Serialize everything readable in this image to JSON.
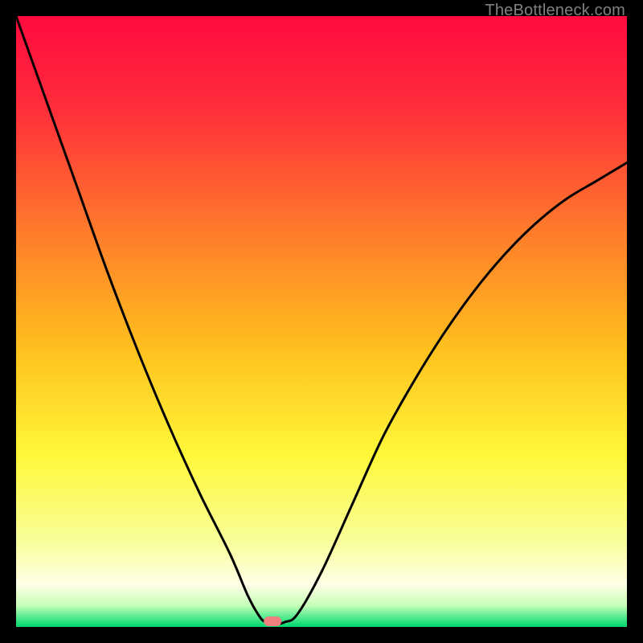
{
  "watermark": "TheBottleneck.com",
  "chart_data": {
    "type": "line",
    "title": "",
    "xlabel": "",
    "ylabel": "",
    "xlim": [
      0,
      100
    ],
    "ylim": [
      0,
      100
    ],
    "x_marker": 42,
    "curve": {
      "x": [
        0,
        5,
        10,
        15,
        20,
        25,
        30,
        35,
        38,
        40,
        41,
        42,
        43,
        44,
        46,
        50,
        55,
        60,
        65,
        70,
        75,
        80,
        85,
        90,
        95,
        100
      ],
      "y": [
        100,
        86,
        72,
        58,
        45,
        33,
        22,
        12,
        5,
        1.5,
        0.8,
        0.5,
        0.5,
        0.8,
        2,
        9,
        20,
        31,
        40,
        48,
        55,
        61,
        66,
        70,
        73,
        76
      ]
    },
    "background_gradient": {
      "stops": [
        {
          "pos": 0.0,
          "color": "#ff0b3f"
        },
        {
          "pos": 0.15,
          "color": "#ff2d3b"
        },
        {
          "pos": 0.35,
          "color": "#ff7a2b"
        },
        {
          "pos": 0.55,
          "color": "#ffc21e"
        },
        {
          "pos": 0.72,
          "color": "#fff83a"
        },
        {
          "pos": 0.86,
          "color": "#f8ff9a"
        },
        {
          "pos": 0.93,
          "color": "#ffffe6"
        },
        {
          "pos": 0.965,
          "color": "#c6ffb8"
        },
        {
          "pos": 0.985,
          "color": "#4fe98d"
        },
        {
          "pos": 1.0,
          "color": "#00d66f"
        }
      ]
    },
    "marker_color": "#f08080",
    "curve_color": "#000000",
    "curve_width": 3
  }
}
